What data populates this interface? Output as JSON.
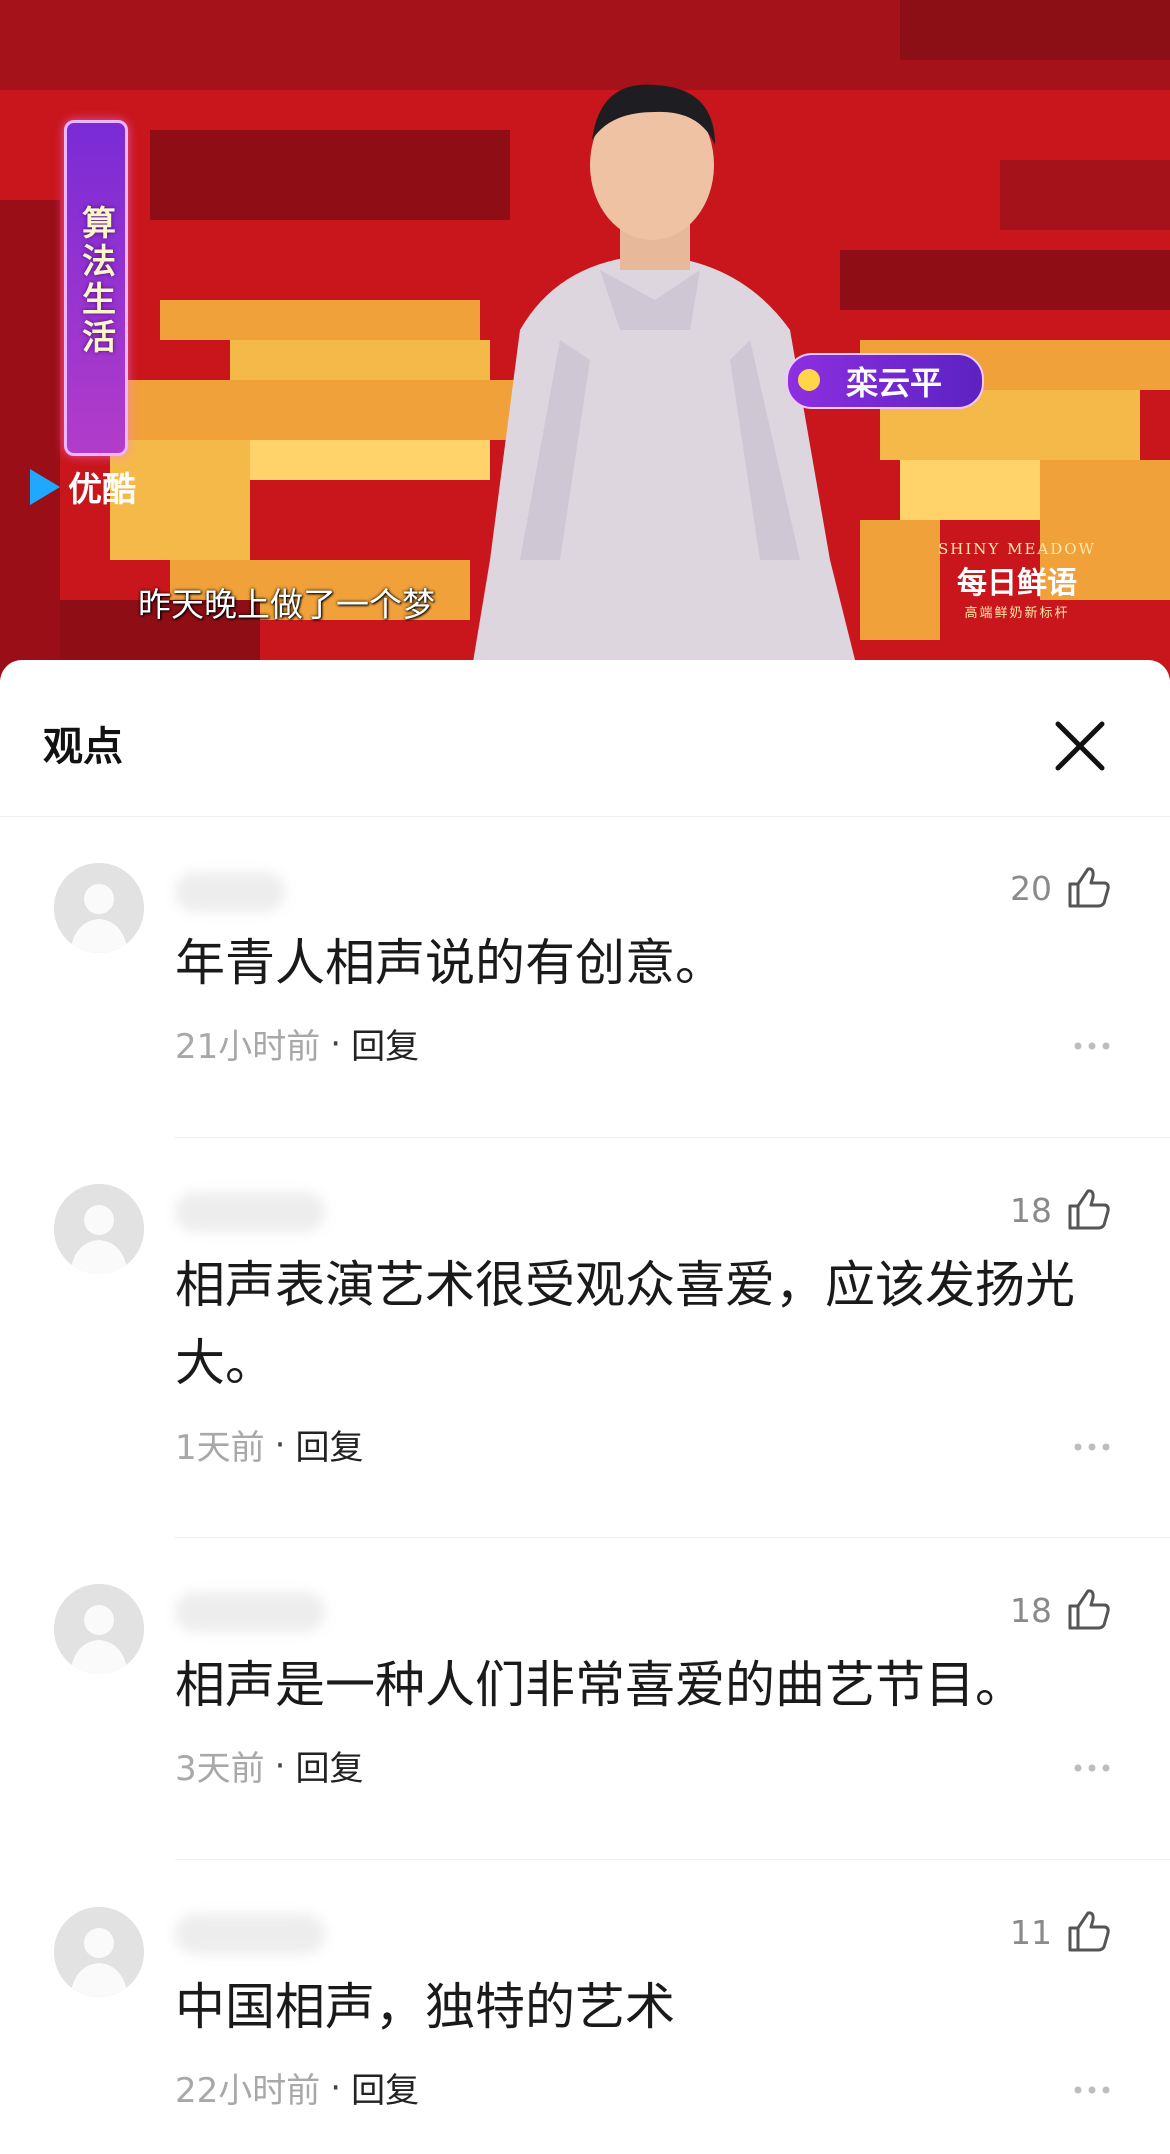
{
  "video": {
    "show_title": "算法生活",
    "brand": "优酷",
    "subtitle": "昨天晚上做了一个梦",
    "name_tag": "栾云平",
    "sponsor": {
      "en": "SHINY MEADOW",
      "cn": "每日鲜语",
      "tagline": "高端鲜奶新标杆"
    }
  },
  "sheet": {
    "title": "观点",
    "close_icon": "close-icon"
  },
  "comments": [
    {
      "likes": "20",
      "text": "年青人相声说的有创意。",
      "time": "21小时前",
      "separator": "·",
      "reply": "回复"
    },
    {
      "likes": "18",
      "text": "相声表演艺术很受观众喜爱，应该发扬光大。",
      "time": "1天前",
      "separator": "·",
      "reply": "回复"
    },
    {
      "likes": "18",
      "text": "相声是一种人们非常喜爱的曲艺节目。",
      "time": "3天前",
      "separator": "·",
      "reply": "回复"
    },
    {
      "likes": "11",
      "text": "中国相声，独特的艺术",
      "time": "22小时前",
      "separator": "·",
      "reply": "回复"
    }
  ],
  "colors": {
    "stage_red": "#b8141a",
    "accent_purple": "#7a2bd6",
    "muted_text": "#a8a8a8"
  }
}
